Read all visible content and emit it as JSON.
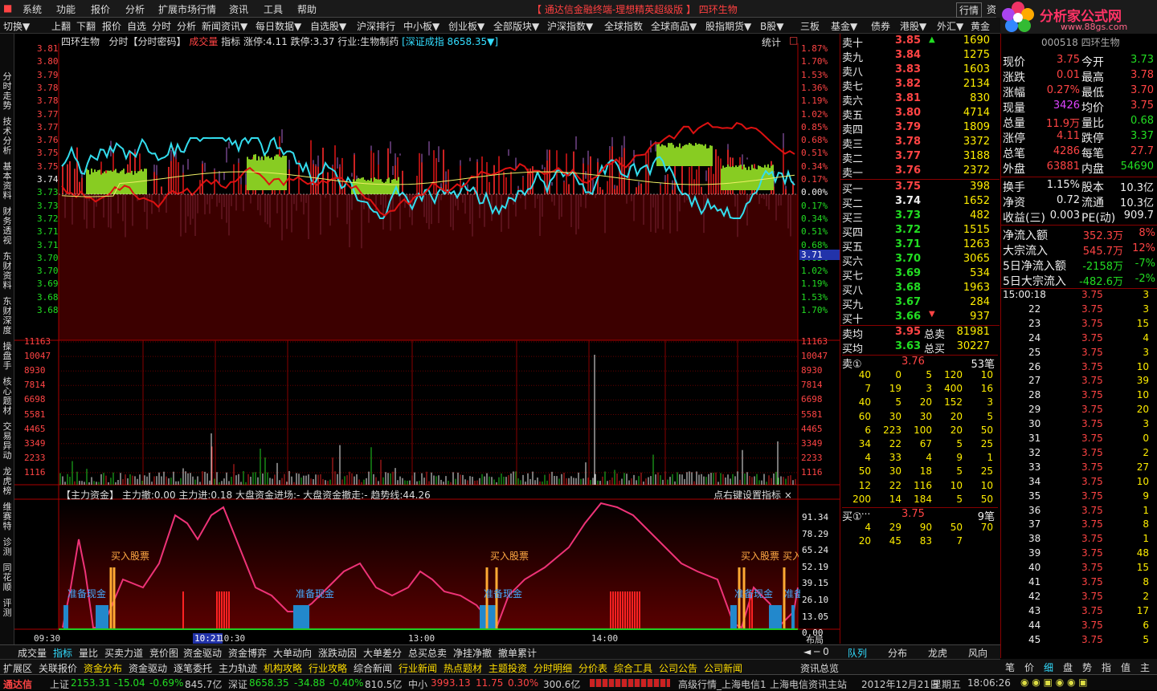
{
  "menu": [
    "系统",
    "功能",
    "报价",
    "分析",
    "扩展市场行情",
    "资讯",
    "工具",
    "帮助"
  ],
  "app_title": "【 通达信金融终端-理想精英超级版 】 四环生物",
  "top_right": [
    "行情",
    "资"
  ],
  "logo": {
    "title": "分析家公式网",
    "url": "www.88gs.com"
  },
  "toolbar": [
    "切换▼",
    "上翻",
    "下翻",
    "报价",
    "自选",
    "分时",
    "分析",
    "新闻资讯▼",
    "每日数据▼",
    "自选股▼",
    "沪深排行",
    "中小板▼",
    "创业板▼",
    "全部版块▼",
    "沪深指数▼",
    "全球指数",
    "全球商品▼",
    "股指期货▼",
    "B股▼",
    "三板",
    "基金▼",
    "债券",
    "港股▼",
    "外汇▼",
    "黄金"
  ],
  "vtabs": [
    "分时走势",
    "技术分析",
    "基本资料",
    "财务透视",
    "东财资料",
    "东财深度",
    "操盘手",
    "核心题材",
    "交易异动",
    "龙虎榜",
    "维赛特",
    "诊测",
    "同花顺",
    "评测"
  ],
  "header": {
    "name": "四环生物",
    "mode": "分时【分时密码】",
    "indicator": "成交量",
    "ind2": "指标",
    "zt": "涨停:4.11",
    "dt": "跌停:3.37",
    "industry": "行业:生物制药",
    "index": "[深证成指 8658.35▼]",
    "stat": "统计"
  },
  "price_axis": [
    "3.81",
    "3.80",
    "3.79",
    "3.78",
    "3.78",
    "3.77",
    "3.77",
    "3.76",
    "3.75",
    "3.75",
    "3.74",
    "3.73",
    "3.73",
    "3.72",
    "3.71",
    "3.71",
    "3.70",
    "3.70",
    "3.69",
    "3.68",
    "3.68"
  ],
  "pct_axis": [
    "1.87%",
    "1.70%",
    "1.53%",
    "1.36%",
    "1.19%",
    "1.02%",
    "0.85%",
    "0.68%",
    "0.51%",
    "0.34%",
    "0.17%",
    "0.00%",
    "0.17%",
    "0.34%",
    "0.51%",
    "0.68%",
    "0.85%",
    "1.02%",
    "1.19%",
    "1.53%",
    "1.70%"
  ],
  "current_price_tag": "3.71",
  "vol_axis": [
    "11163",
    "10047",
    "8930",
    "7814",
    "6698",
    "5581",
    "4465",
    "3349",
    "2233",
    "1116"
  ],
  "ind_header": "【主力资金】 主力撤:0.00 主力进:0.18 大盘资金进场:- 大盘资金撤走:- 趋势线:44.26",
  "ind_right": "点右键设置指标 ×",
  "ind_axis": [
    "91.34",
    "78.29",
    "65.24",
    "52.19",
    "39.15",
    "26.10",
    "13.05",
    "0.00"
  ],
  "ind_labels": {
    "buy": "买入股票",
    "ready": "准备现金"
  },
  "time_axis": [
    "09:30",
    "10:21",
    "10:30",
    "13:00",
    "14:00",
    "布局"
  ],
  "sell_orders": [
    [
      "卖十",
      "3.85",
      "1690"
    ],
    [
      "卖九",
      "3.84",
      "1275"
    ],
    [
      "卖八",
      "3.83",
      "1603"
    ],
    [
      "卖七",
      "3.82",
      "2134"
    ],
    [
      "卖六",
      "3.81",
      "830"
    ],
    [
      "卖五",
      "3.80",
      "4714"
    ],
    [
      "卖四",
      "3.79",
      "1809"
    ],
    [
      "卖三",
      "3.78",
      "3372"
    ],
    [
      "卖二",
      "3.77",
      "3188"
    ],
    [
      "卖一",
      "3.76",
      "2372"
    ]
  ],
  "buy_orders": [
    [
      "买一",
      "3.75",
      "398"
    ],
    [
      "买二",
      "3.74",
      "1652"
    ],
    [
      "买三",
      "3.73",
      "482"
    ],
    [
      "买四",
      "3.72",
      "1515"
    ],
    [
      "买五",
      "3.71",
      "1263"
    ],
    [
      "买六",
      "3.70",
      "3065"
    ],
    [
      "买七",
      "3.69",
      "534"
    ],
    [
      "买八",
      "3.68",
      "1963"
    ],
    [
      "买九",
      "3.67",
      "284"
    ],
    [
      "买十",
      "3.66",
      "937"
    ]
  ],
  "avg": [
    [
      "卖均",
      "3.95",
      "总卖",
      "81981"
    ],
    [
      "买均",
      "3.63",
      "总买",
      "30227"
    ]
  ],
  "sell1": {
    "label": "卖①",
    "price": "3.76",
    "count": "53笔"
  },
  "sell1_queue": [
    [
      "40",
      "0",
      "5",
      "120",
      "10"
    ],
    [
      "7",
      "19",
      "3",
      "400",
      "16"
    ],
    [
      "40",
      "5",
      "20",
      "152",
      "3"
    ],
    [
      "60",
      "30",
      "30",
      "20",
      "5"
    ],
    [
      "6",
      "223",
      "100",
      "20",
      "50"
    ],
    [
      "34",
      "22",
      "67",
      "5",
      "25"
    ],
    [
      "4",
      "33",
      "4",
      "9",
      "1"
    ],
    [
      "50",
      "30",
      "18",
      "5",
      "25"
    ],
    [
      "12",
      "22",
      "116",
      "10",
      "10"
    ],
    [
      "200",
      "14",
      "184",
      "5",
      "50"
    ]
  ],
  "buy1": {
    "label": "买①",
    "price": "3.75",
    "count": "9笔"
  },
  "buy1_queue": [
    [
      "4",
      "29",
      "90",
      "50",
      "70"
    ],
    [
      "20",
      "45",
      "83",
      "7",
      ""
    ]
  ],
  "stock_code": "000518 四环生物",
  "quote": [
    [
      "现价",
      "3.75",
      "今开",
      "3.73"
    ],
    [
      "涨跌",
      "0.01",
      "最高",
      "3.78"
    ],
    [
      "涨幅",
      "0.27%",
      "最低",
      "3.70"
    ],
    [
      "现量",
      "3426",
      "均价",
      "3.75"
    ],
    [
      "总量",
      "11.9万",
      "量比",
      "0.68"
    ],
    [
      "涨停",
      "4.11",
      "跌停",
      "3.37"
    ],
    [
      "总笔",
      "4286",
      "每笔",
      "27.7"
    ],
    [
      "外盘",
      "63881",
      "内盘",
      "54690"
    ]
  ],
  "quote2": [
    [
      "换手",
      "1.15%",
      "股本",
      "10.3亿"
    ],
    [
      "净资",
      "0.72",
      "流通",
      "10.3亿"
    ],
    [
      "收益(三)",
      "0.003",
      "PE(动)",
      "909.7"
    ]
  ],
  "flow": [
    [
      "净流入额",
      "352.3万",
      "8%"
    ],
    [
      "大宗流入",
      "545.7万",
      "12%"
    ],
    [
      "5日净流入额",
      "-2158万",
      "-7%"
    ],
    [
      "5日大宗流入",
      "-482.6万",
      "-2%"
    ]
  ],
  "ticks": [
    [
      "15:00:18",
      "3.75",
      "3"
    ],
    [
      "22",
      "3.75",
      "3"
    ],
    [
      "23",
      "3.75",
      "15"
    ],
    [
      "24",
      "3.75",
      "4"
    ],
    [
      "25",
      "3.75",
      "3"
    ],
    [
      "26",
      "3.75",
      "10"
    ],
    [
      "27",
      "3.75",
      "39"
    ],
    [
      "28",
      "3.75",
      "10"
    ],
    [
      "29",
      "3.75",
      "20"
    ],
    [
      "30",
      "3.75",
      "3"
    ],
    [
      "31",
      "3.75",
      "0"
    ],
    [
      "32",
      "3.75",
      "2"
    ],
    [
      "33",
      "3.75",
      "27"
    ],
    [
      "34",
      "3.75",
      "10"
    ],
    [
      "35",
      "3.75",
      "9"
    ],
    [
      "36",
      "3.75",
      "1"
    ],
    [
      "37",
      "3.75",
      "8"
    ],
    [
      "38",
      "3.75",
      "1"
    ],
    [
      "39",
      "3.75",
      "48"
    ],
    [
      "40",
      "3.75",
      "15"
    ],
    [
      "41",
      "3.75",
      "8"
    ],
    [
      "42",
      "3.75",
      "2"
    ],
    [
      "43",
      "3.75",
      "17"
    ],
    [
      "44",
      "3.75",
      "6"
    ],
    [
      "45",
      "3.75",
      "5"
    ]
  ],
  "bottom_tabs": [
    "成交量",
    "指标",
    "量比",
    "买卖力道",
    "竞价图",
    "资金驱动",
    "资金博弈",
    "大单动向",
    "涨跌动因",
    "大单差分",
    "总买总卖",
    "净挂净撤",
    "撤单累计"
  ],
  "bottom_right": [
    "队列",
    "分布",
    "龙虎",
    "风向"
  ],
  "quote_tabs": [
    "笔",
    "价",
    "细",
    "盘",
    "势",
    "指",
    "值",
    "主"
  ],
  "bottom_tabs2": [
    "扩展区",
    "关联报价",
    "资金分布",
    "资金驱动",
    "逐笔委托",
    "主力轨迹",
    "机构攻略",
    "行业攻略",
    "综合新闻",
    "行业新闻",
    "热点题材",
    "主题投资",
    "分时明细",
    "分价表",
    "综合工具",
    "公司公告",
    "公司新闻",
    "资讯总览"
  ],
  "status": {
    "brand": "通达信",
    "sh": "上证",
    "sh_val": "2153.31",
    "sh_chg": "-15.04",
    "sh_pct": "-0.69%",
    "sh_amt": "845.7亿",
    "sz": "深证",
    "sz_val": "8658.35",
    "sz_chg": "-34.88",
    "sz_pct": "-0.40%",
    "sz_amt": "810.5亿",
    "zx": "中小",
    "zx_val": "3993.13",
    "zx_chg": "11.75",
    "zx_pct": "0.30%",
    "zx_amt": "300.6亿",
    "server": "高级行情_上海电信1",
    "info": "上海电信资讯主站",
    "date": "2012年12月21日",
    "weekday": "星期五",
    "time": "18:06:26"
  }
}
